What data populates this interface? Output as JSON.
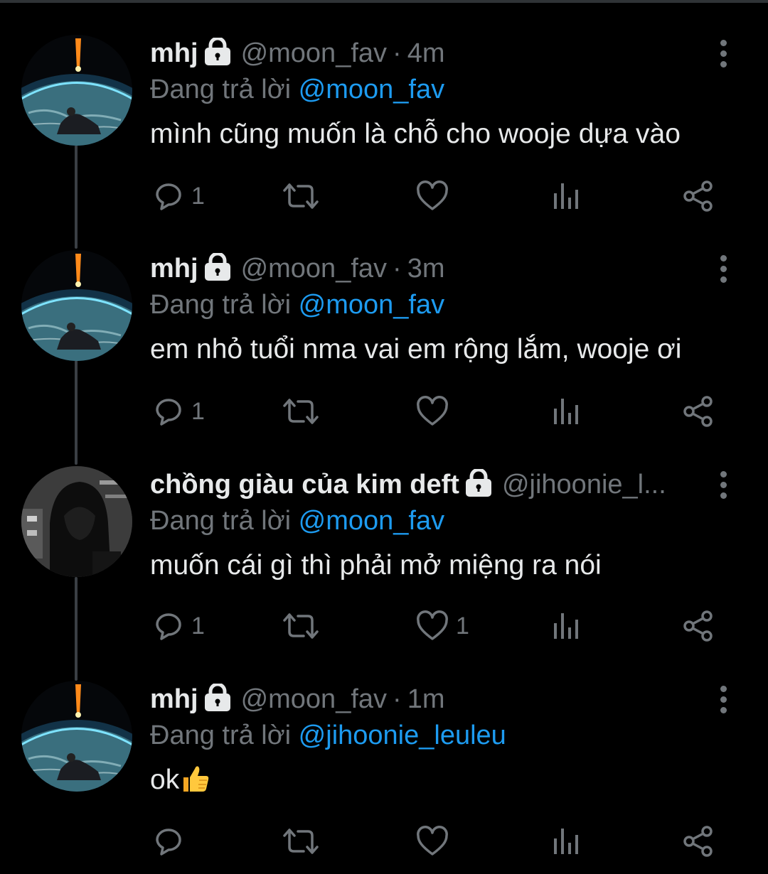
{
  "colors": {
    "background": "#000000",
    "text": "#e7e9ea",
    "muted": "#71767b",
    "mention": "#1d9bf0",
    "thread_line": "#3a3f44"
  },
  "labels": {
    "replying_prefix": "Đang trả lời",
    "separator": "·"
  },
  "tweets": [
    {
      "display_name": "mhj",
      "handle": "@moon_fav",
      "time": "4m",
      "reply_to": "@moon_fav",
      "text": "mình cũng muốn là chỗ cho wooje dựa vào",
      "avatar": "earth-horizon-avatar",
      "counts": {
        "reply": "1",
        "retweet": "",
        "like": ""
      }
    },
    {
      "display_name": "mhj",
      "handle": "@moon_fav",
      "time": "3m",
      "reply_to": "@moon_fav",
      "text": "em nhỏ tuổi nma vai em rộng lắm, wooje ơi",
      "avatar": "earth-horizon-avatar",
      "counts": {
        "reply": "1",
        "retweet": "",
        "like": ""
      }
    },
    {
      "display_name": "chồng giàu của kim deft",
      "handle": "@jihoonie_l...",
      "time": "",
      "reply_to": "@moon_fav",
      "text": "muốn cái gì thì phải mở miệng ra nói",
      "avatar": "hooded-figure-avatar",
      "counts": {
        "reply": "1",
        "retweet": "",
        "like": "1"
      }
    },
    {
      "display_name": "mhj",
      "handle": "@moon_fav",
      "time": "1m",
      "reply_to": "@jihoonie_leuleu",
      "text": "ok",
      "text_emoji": "thumbs-up-emoji",
      "avatar": "earth-horizon-avatar",
      "counts": {
        "reply": "",
        "retweet": "",
        "like": ""
      }
    }
  ]
}
